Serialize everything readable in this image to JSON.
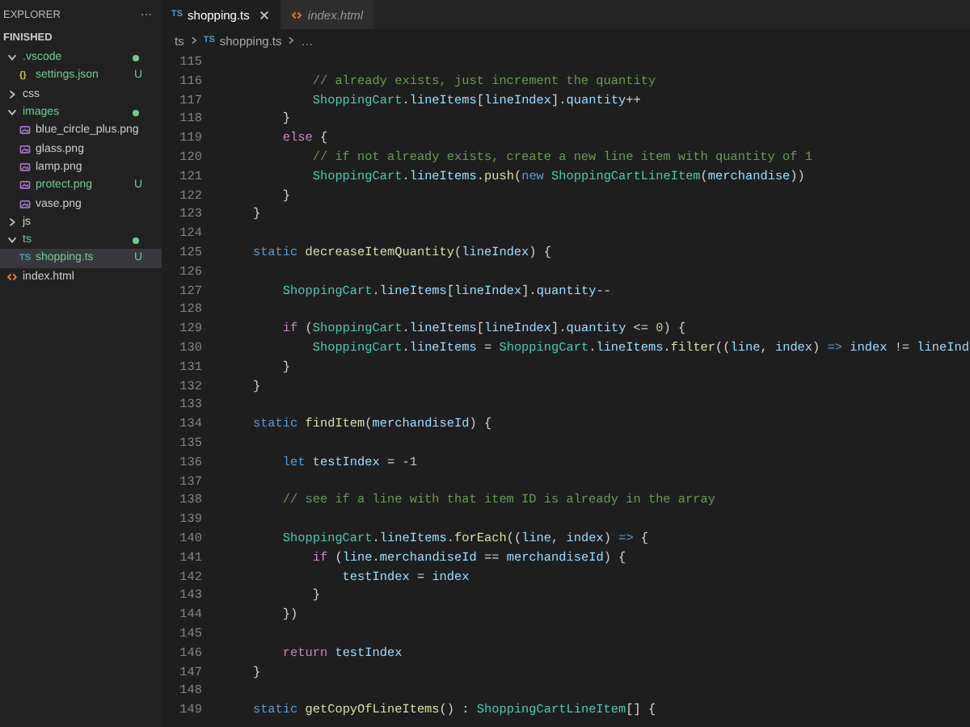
{
  "sidebar": {
    "title": "EXPLORER",
    "more": "···",
    "section": "FINISHED",
    "tree": [
      {
        "name": ".vscode",
        "kind": "folder",
        "expanded": true,
        "untracked": true,
        "changes_inside": true,
        "children": [
          {
            "name": "settings.json",
            "kind": "json",
            "icon_label": "{}",
            "untracked": true,
            "badge": "U",
            "selected": false
          }
        ]
      },
      {
        "name": "css",
        "kind": "folder",
        "expanded": false,
        "untracked": false,
        "changes_inside": false
      },
      {
        "name": "images",
        "kind": "folder",
        "expanded": true,
        "untracked": true,
        "changes_inside": true,
        "children": [
          {
            "name": "blue_circle_plus.png",
            "kind": "image",
            "untracked": false,
            "selected": false
          },
          {
            "name": "glass.png",
            "kind": "image",
            "untracked": false,
            "selected": false
          },
          {
            "name": "lamp.png",
            "kind": "image",
            "untracked": false,
            "selected": false
          },
          {
            "name": "protect.png",
            "kind": "image",
            "untracked": true,
            "badge": "U",
            "selected": false
          },
          {
            "name": "vase.png",
            "kind": "image",
            "untracked": false,
            "selected": false
          }
        ]
      },
      {
        "name": "js",
        "kind": "folder",
        "expanded": false,
        "untracked": false,
        "changes_inside": false
      },
      {
        "name": "ts",
        "kind": "folder",
        "expanded": true,
        "untracked": true,
        "changes_inside": true,
        "children": [
          {
            "name": "shopping.ts",
            "kind": "ts",
            "icon_label": "TS",
            "untracked": true,
            "badge": "U",
            "selected": true
          }
        ]
      },
      {
        "name": "index.html",
        "kind": "html",
        "untracked": false,
        "selected": false
      }
    ]
  },
  "tabs": [
    {
      "label": "shopping.ts",
      "kind": "ts",
      "icon_label": "TS",
      "selected": true,
      "preview": false
    },
    {
      "label": "index.html",
      "kind": "html",
      "selected": false,
      "preview": true
    }
  ],
  "breadcrumb": {
    "folder": "ts",
    "file_icon_label": "TS",
    "file": "shopping.ts",
    "more": "…"
  },
  "code": [
    {
      "number": "115"
    },
    {
      "number": "116",
      "tokens": [
        {
          "kind": "comment",
          "text": "            // already exists, just increment the quantity"
        }
      ]
    },
    {
      "number": "117",
      "tokens": [
        {
          "kind": "class",
          "text": "            ShoppingCart"
        },
        {
          "kind": "plain",
          "text": "."
        },
        {
          "kind": "var",
          "text": "lineItems"
        },
        {
          "kind": "plain",
          "text": "["
        },
        {
          "kind": "var",
          "text": "lineIndex"
        },
        {
          "kind": "plain",
          "text": "]."
        },
        {
          "kind": "var",
          "text": "quantity"
        },
        {
          "kind": "plain",
          "text": "++"
        }
      ]
    },
    {
      "number": "118",
      "tokens": [
        {
          "kind": "plain",
          "text": "        }"
        }
      ]
    },
    {
      "number": "119",
      "tokens": [
        {
          "kind": "control",
          "text": "        else"
        },
        {
          "kind": "plain",
          "text": " {"
        }
      ]
    },
    {
      "number": "120",
      "tokens": [
        {
          "kind": "comment",
          "text": "            // if not already exists, create a new line item with quantity of 1"
        }
      ]
    },
    {
      "number": "121",
      "tokens": [
        {
          "kind": "class",
          "text": "            ShoppingCart"
        },
        {
          "kind": "plain",
          "text": "."
        },
        {
          "kind": "var",
          "text": "lineItems"
        },
        {
          "kind": "plain",
          "text": "."
        },
        {
          "kind": "function",
          "text": "push"
        },
        {
          "kind": "plain",
          "text": "("
        },
        {
          "kind": "keyword",
          "text": "new "
        },
        {
          "kind": "class",
          "text": "ShoppingCartLineItem"
        },
        {
          "kind": "plain",
          "text": "("
        },
        {
          "kind": "var",
          "text": "merchandise"
        },
        {
          "kind": "plain",
          "text": "))"
        }
      ]
    },
    {
      "number": "122",
      "tokens": [
        {
          "kind": "plain",
          "text": "        }"
        }
      ]
    },
    {
      "number": "123",
      "tokens": [
        {
          "kind": "plain",
          "text": "    }"
        }
      ]
    },
    {
      "number": "124"
    },
    {
      "number": "125",
      "tokens": [
        {
          "kind": "keyword",
          "text": "    static "
        },
        {
          "kind": "function",
          "text": "decreaseItemQuantity"
        },
        {
          "kind": "plain",
          "text": "("
        },
        {
          "kind": "var",
          "text": "lineIndex"
        },
        {
          "kind": "plain",
          "text": ") {"
        }
      ]
    },
    {
      "number": "126"
    },
    {
      "number": "127",
      "tokens": [
        {
          "kind": "class",
          "text": "        ShoppingCart"
        },
        {
          "kind": "plain",
          "text": "."
        },
        {
          "kind": "var",
          "text": "lineItems"
        },
        {
          "kind": "plain",
          "text": "["
        },
        {
          "kind": "var",
          "text": "lineIndex"
        },
        {
          "kind": "plain",
          "text": "]."
        },
        {
          "kind": "var",
          "text": "quantity"
        },
        {
          "kind": "plain",
          "text": "--"
        }
      ]
    },
    {
      "number": "128"
    },
    {
      "number": "129",
      "tokens": [
        {
          "kind": "control",
          "text": "        if"
        },
        {
          "kind": "plain",
          "text": " ("
        },
        {
          "kind": "class",
          "text": "ShoppingCart"
        },
        {
          "kind": "plain",
          "text": "."
        },
        {
          "kind": "var",
          "text": "lineItems"
        },
        {
          "kind": "plain",
          "text": "["
        },
        {
          "kind": "var",
          "text": "lineIndex"
        },
        {
          "kind": "plain",
          "text": "]."
        },
        {
          "kind": "var",
          "text": "quantity"
        },
        {
          "kind": "plain",
          "text": " <= "
        },
        {
          "kind": "number",
          "text": "0"
        },
        {
          "kind": "plain",
          "text": ") {"
        }
      ]
    },
    {
      "number": "130",
      "tokens": [
        {
          "kind": "class",
          "text": "            ShoppingCart"
        },
        {
          "kind": "plain",
          "text": "."
        },
        {
          "kind": "var",
          "text": "lineItems"
        },
        {
          "kind": "plain",
          "text": " = "
        },
        {
          "kind": "class",
          "text": "ShoppingCart"
        },
        {
          "kind": "plain",
          "text": "."
        },
        {
          "kind": "var",
          "text": "lineItems"
        },
        {
          "kind": "plain",
          "text": "."
        },
        {
          "kind": "function",
          "text": "filter"
        },
        {
          "kind": "plain",
          "text": "(("
        },
        {
          "kind": "var",
          "text": "line"
        },
        {
          "kind": "plain",
          "text": ", "
        },
        {
          "kind": "var",
          "text": "index"
        },
        {
          "kind": "plain",
          "text": ") "
        },
        {
          "kind": "keyword",
          "text": "=> "
        },
        {
          "kind": "var",
          "text": "index"
        },
        {
          "kind": "plain",
          "text": " != "
        },
        {
          "kind": "var",
          "text": "lineInd"
        }
      ]
    },
    {
      "number": "131",
      "tokens": [
        {
          "kind": "plain",
          "text": "        }"
        }
      ]
    },
    {
      "number": "132",
      "tokens": [
        {
          "kind": "plain",
          "text": "    }"
        }
      ]
    },
    {
      "number": "133"
    },
    {
      "number": "134",
      "tokens": [
        {
          "kind": "keyword",
          "text": "    static "
        },
        {
          "kind": "function",
          "text": "findItem"
        },
        {
          "kind": "plain",
          "text": "("
        },
        {
          "kind": "var",
          "text": "merchandiseId"
        },
        {
          "kind": "plain",
          "text": ") {"
        }
      ]
    },
    {
      "number": "135"
    },
    {
      "number": "136",
      "tokens": [
        {
          "kind": "keyword",
          "text": "        let "
        },
        {
          "kind": "var",
          "text": "testIndex"
        },
        {
          "kind": "plain",
          "text": " = -"
        },
        {
          "kind": "number",
          "text": "1"
        }
      ]
    },
    {
      "number": "137"
    },
    {
      "number": "138",
      "tokens": [
        {
          "kind": "comment",
          "text": "        // see if a line with that item ID is already in the array"
        }
      ]
    },
    {
      "number": "139"
    },
    {
      "number": "140",
      "tokens": [
        {
          "kind": "class",
          "text": "        ShoppingCart"
        },
        {
          "kind": "plain",
          "text": "."
        },
        {
          "kind": "var",
          "text": "lineItems"
        },
        {
          "kind": "plain",
          "text": "."
        },
        {
          "kind": "function",
          "text": "forEach"
        },
        {
          "kind": "plain",
          "text": "(("
        },
        {
          "kind": "var",
          "text": "line"
        },
        {
          "kind": "plain",
          "text": ", "
        },
        {
          "kind": "var",
          "text": "index"
        },
        {
          "kind": "plain",
          "text": ") "
        },
        {
          "kind": "keyword",
          "text": "=>"
        },
        {
          "kind": "plain",
          "text": " {"
        }
      ]
    },
    {
      "number": "141",
      "tokens": [
        {
          "kind": "control",
          "text": "            if"
        },
        {
          "kind": "plain",
          "text": " ("
        },
        {
          "kind": "var",
          "text": "line"
        },
        {
          "kind": "plain",
          "text": "."
        },
        {
          "kind": "var",
          "text": "merchandiseId"
        },
        {
          "kind": "plain",
          "text": " == "
        },
        {
          "kind": "var",
          "text": "merchandiseId"
        },
        {
          "kind": "plain",
          "text": ") {"
        }
      ]
    },
    {
      "number": "142",
      "tokens": [
        {
          "kind": "var",
          "text": "                testIndex"
        },
        {
          "kind": "plain",
          "text": " = "
        },
        {
          "kind": "var",
          "text": "index"
        }
      ]
    },
    {
      "number": "143",
      "tokens": [
        {
          "kind": "plain",
          "text": "            }"
        }
      ]
    },
    {
      "number": "144",
      "tokens": [
        {
          "kind": "plain",
          "text": "        })"
        }
      ]
    },
    {
      "number": "145"
    },
    {
      "number": "146",
      "tokens": [
        {
          "kind": "control",
          "text": "        return "
        },
        {
          "kind": "var",
          "text": "testIndex"
        }
      ]
    },
    {
      "number": "147",
      "tokens": [
        {
          "kind": "plain",
          "text": "    }"
        }
      ]
    },
    {
      "number": "148"
    },
    {
      "number": "149",
      "tokens": [
        {
          "kind": "keyword",
          "text": "    static "
        },
        {
          "kind": "function",
          "text": "getCopyOfLineItems"
        },
        {
          "kind": "plain",
          "text": "() : "
        },
        {
          "kind": "class",
          "text": "ShoppingCartLineItem"
        },
        {
          "kind": "plain",
          "text": "[] {"
        }
      ]
    }
  ]
}
